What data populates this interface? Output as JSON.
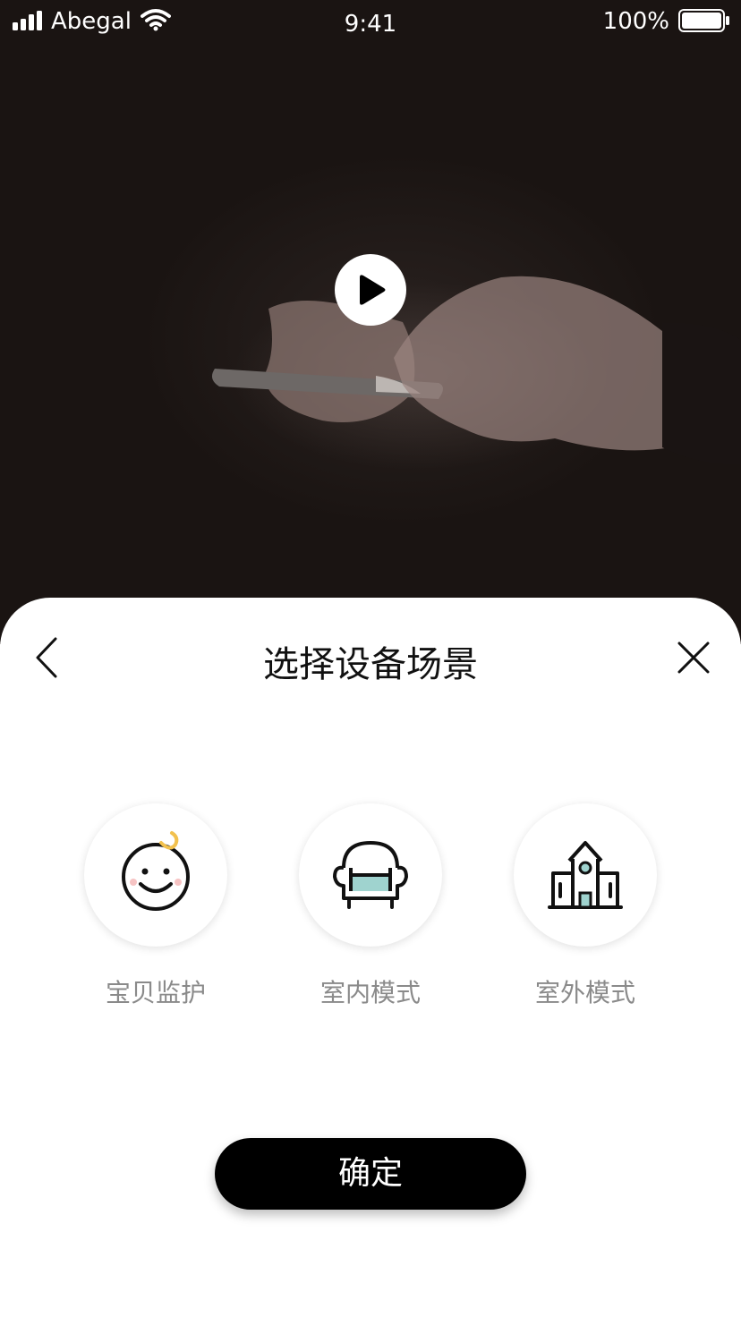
{
  "status_bar": {
    "carrier": "Abegal",
    "time": "9:41",
    "battery": "100%"
  },
  "video": {
    "play_icon": "play-icon"
  },
  "sheet": {
    "title": "选择设备场景",
    "back_icon": "chevron-left-icon",
    "close_icon": "close-icon",
    "scenes": [
      {
        "label": "宝贝监护",
        "icon": "baby-face-icon"
      },
      {
        "label": "室内模式",
        "icon": "armchair-icon"
      },
      {
        "label": "室外模式",
        "icon": "building-icon"
      }
    ],
    "confirm_label": "确定"
  },
  "colors": {
    "accent_yellow": "#f2c14e",
    "accent_teal": "#9fd3cf",
    "cheek_pink": "#f6c3c3",
    "button_bg": "#000000"
  }
}
